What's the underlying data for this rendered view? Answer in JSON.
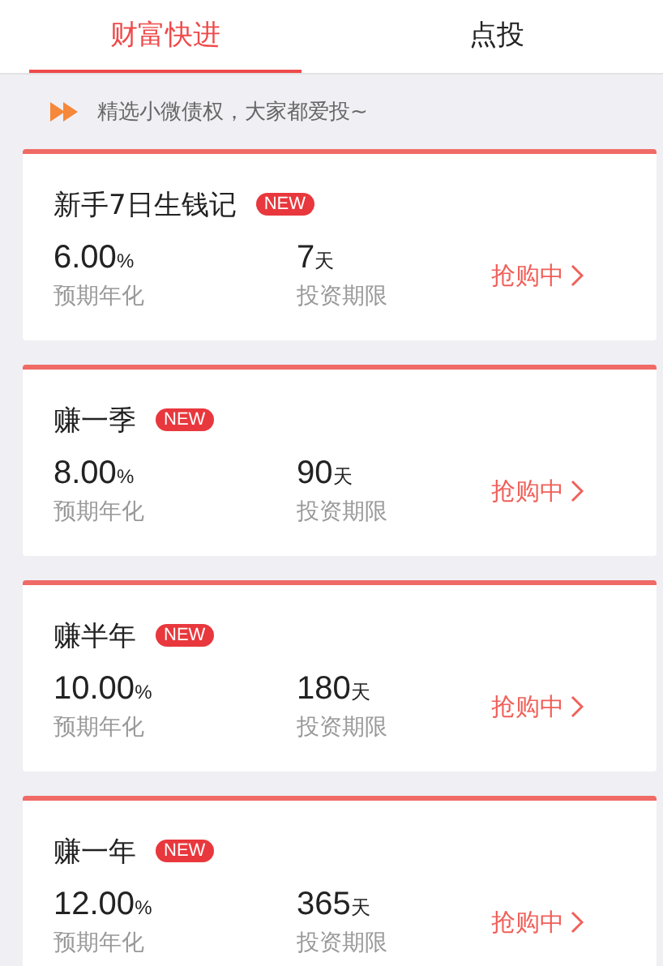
{
  "tabs": [
    {
      "label": "财富快进",
      "selected": true
    },
    {
      "label": "点投",
      "selected": false
    }
  ],
  "banner": {
    "text": "精选小微债权，大家都爱投~"
  },
  "products": [
    {
      "name": "新手7日生钱记",
      "badge": "NEW",
      "rate": "6.00",
      "rate_unit": "%",
      "rate_label": "预期年化",
      "term": "7",
      "term_unit": "天",
      "term_label": "投资期限",
      "action": "抢购中"
    },
    {
      "name": "赚一季",
      "badge": "NEW",
      "rate": "8.00",
      "rate_unit": "%",
      "rate_label": "预期年化",
      "term": "90",
      "term_unit": "天",
      "term_label": "投资期限",
      "action": "抢购中"
    },
    {
      "name": "赚半年",
      "badge": "NEW",
      "rate": "10.00",
      "rate_unit": "%",
      "rate_label": "预期年化",
      "term": "180",
      "term_unit": "天",
      "term_label": "投资期限",
      "action": "抢购中"
    },
    {
      "name": "赚一年",
      "badge": "NEW",
      "rate": "12.00",
      "rate_unit": "%",
      "rate_label": "预期年化",
      "term": "365",
      "term_unit": "天",
      "term_label": "投资期限",
      "action": "抢购中"
    }
  ]
}
